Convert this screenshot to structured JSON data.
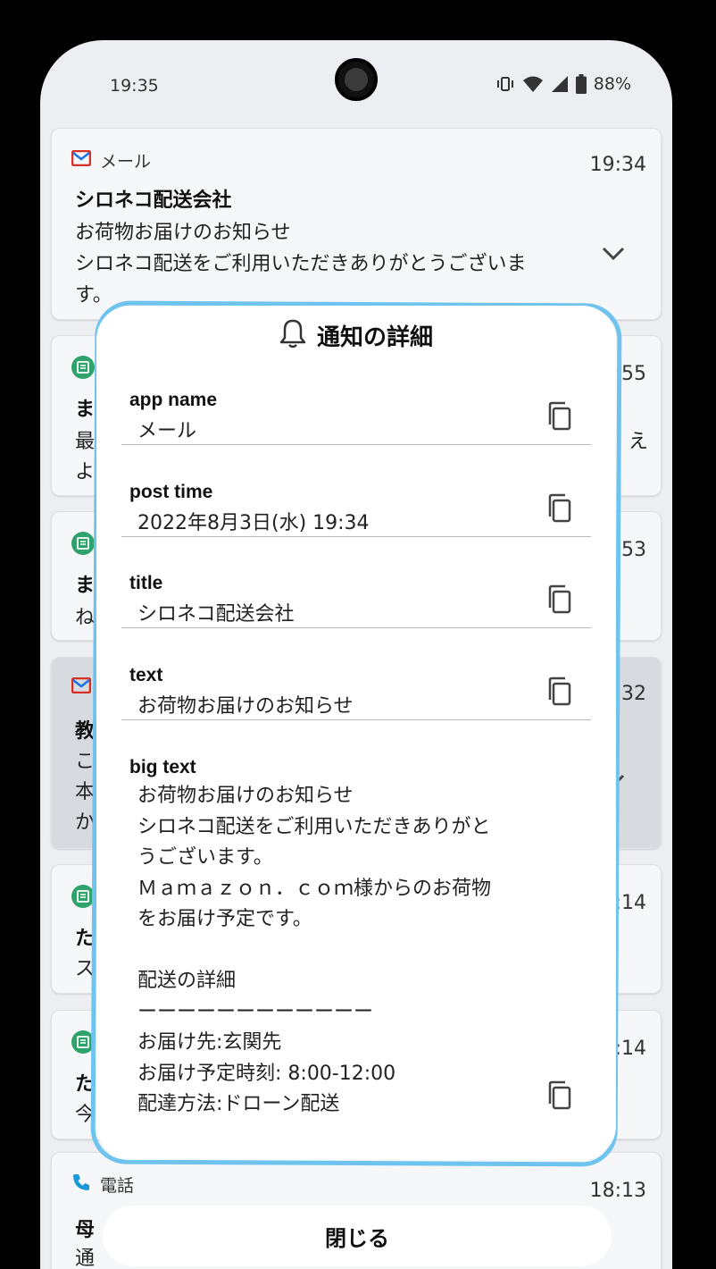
{
  "status": {
    "time": "19:35",
    "battery": "88%"
  },
  "notifications": [
    {
      "app": "メール",
      "time": "19:34",
      "title": "シロネコ配送会社",
      "lines": [
        "お荷物お届けのお知らせ",
        "シロネコ配送をご利用いただきありがとうございま",
        "す。"
      ]
    },
    {
      "title_fragment": "ま",
      "time_fragment": "8:55",
      "lines": [
        "最",
        "よ"
      ],
      "right_fragment": "え"
    },
    {
      "title_fragment": "ま",
      "time_fragment": ":53",
      "lines": [
        "ね"
      ]
    },
    {
      "title_fragment": "教",
      "time_fragment": ":32",
      "lines": [
        "こ",
        "本",
        "か"
      ]
    },
    {
      "title_fragment": "た",
      "time_fragment": ":14",
      "lines": [
        "ス"
      ]
    },
    {
      "title_fragment": "た",
      "time_fragment": ":14",
      "lines": [
        "今"
      ]
    },
    {
      "app": "電話",
      "time": "18:13",
      "title_fragment": "母",
      "lines": [
        "通"
      ]
    }
  ],
  "dialog": {
    "title": "通知の詳細",
    "fields": [
      {
        "label": "app name",
        "value": "メール"
      },
      {
        "label": "post time",
        "value": "2022年8月3日(水) 19:34"
      },
      {
        "label": "title",
        "value": "シロネコ配送会社"
      },
      {
        "label": "text",
        "value": "お荷物お届けのお知らせ"
      }
    ],
    "big_text": {
      "label": "big text",
      "lines": [
        "お荷物お届けのお知らせ",
        "シロネコ配送をご利用いただきありがと",
        "うございます。",
        "Ｍａｍａｚｏｎ．ｃｏｍ様からのお荷物",
        "をお届け予定です。",
        "",
        "配送の詳細",
        "ーーーーーーーーーーーー",
        "お届け先:玄関先",
        "お届け予定時刻: 8:00-12:00",
        "配達方法:ドローン配送"
      ]
    },
    "close_label": "閉じる"
  },
  "icons": {
    "copy": "copy-icon",
    "bell": "bell-icon",
    "mail": "mail-icon",
    "chat": "chat-icon",
    "phone": "phone-icon"
  }
}
